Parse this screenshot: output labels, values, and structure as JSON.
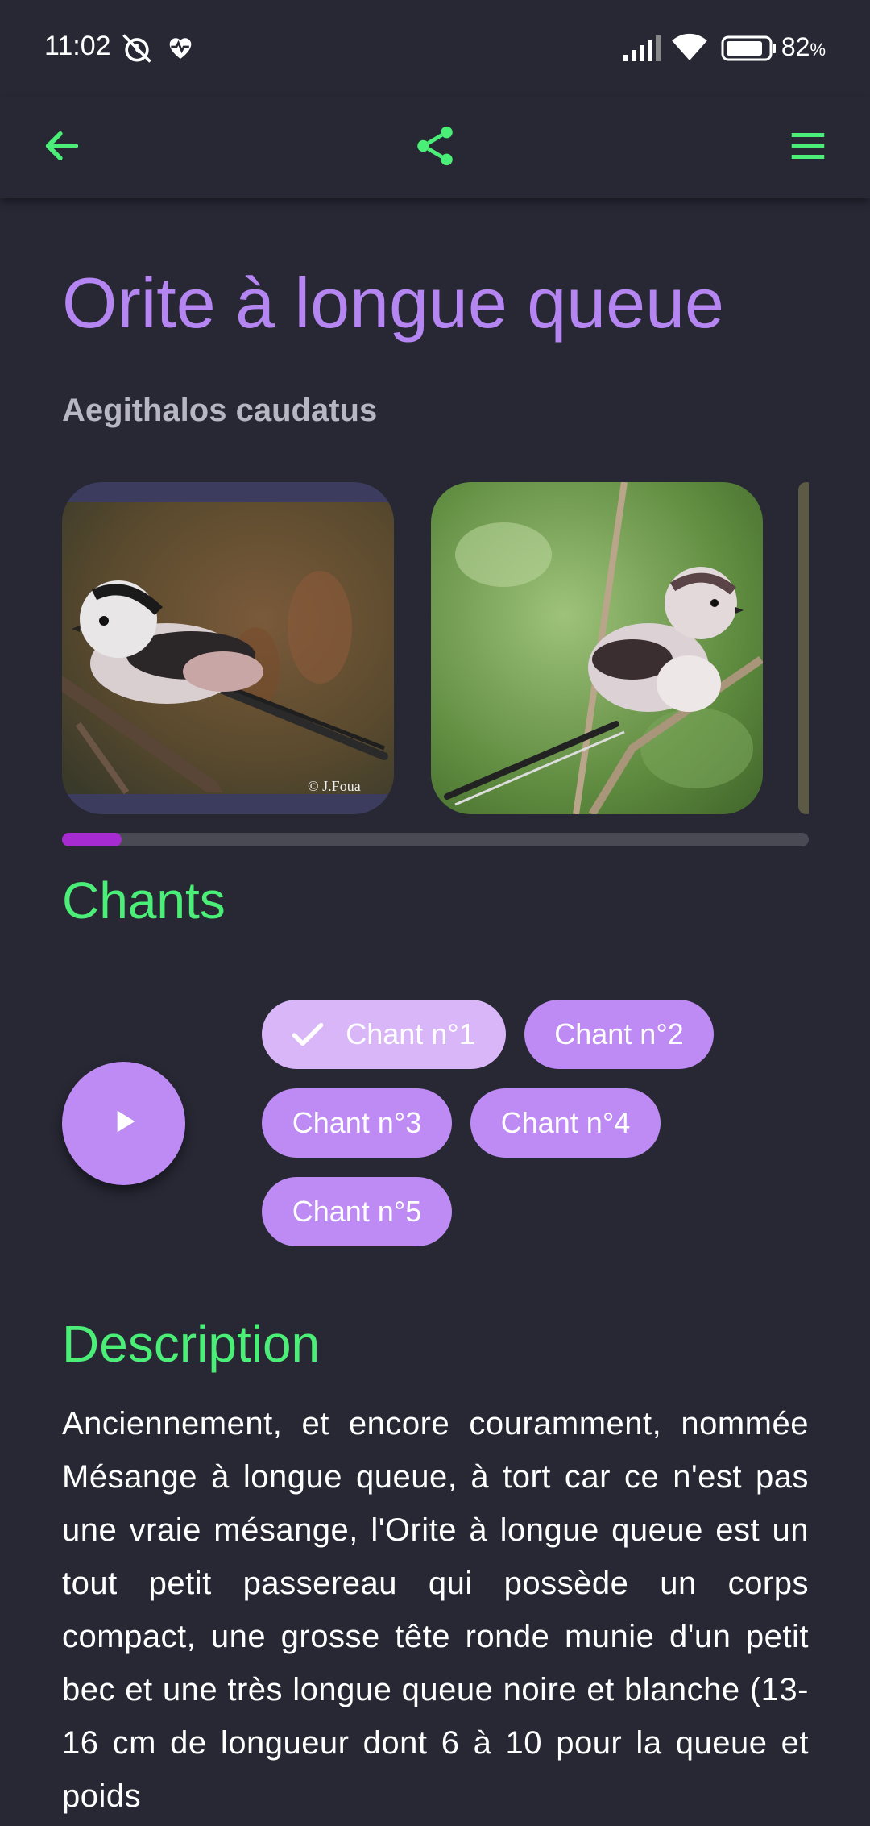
{
  "status_bar": {
    "time": "11:02",
    "battery_percent": "82",
    "battery_unit": "%",
    "icons": [
      "alarm-off-icon",
      "heart-pulse-icon",
      "signal-icon",
      "wifi-icon",
      "battery-icon"
    ]
  },
  "app_bar": {
    "accent": "#4bef77",
    "icons": [
      "back-arrow-icon",
      "share-icon",
      "menu-icon"
    ]
  },
  "bird": {
    "common_name": "Orite à longue queue",
    "scientific_name": "Aegithalos caudatus"
  },
  "gallery": {
    "photo_credit": "© J.Foua",
    "scroll_position": 0.08
  },
  "songs": {
    "section_title": "Chants",
    "chips": [
      "Chant n°1",
      "Chant n°2",
      "Chant n°3",
      "Chant n°4",
      "Chant n°5"
    ],
    "selected_index": 0
  },
  "description": {
    "section_title": "Description",
    "text": "Anciennement, et encore couramment, nommée Mésange à longue queue, à tort car ce n'est pas une vraie mésange, l'Orite à longue queue est un tout petit passereau qui possède un corps compact, une grosse tête ronde munie d'un petit bec et une très longue queue noire et blanche (13-16 cm de longueur dont 6 à 10 pour la queue et poids"
  },
  "colors": {
    "background": "#272834",
    "title": "#b585f2",
    "section": "#4bef77",
    "chip": "#bd8bf3",
    "chip_selected": "#d8b6f8",
    "scroll_thumb": "#a62bd0"
  }
}
